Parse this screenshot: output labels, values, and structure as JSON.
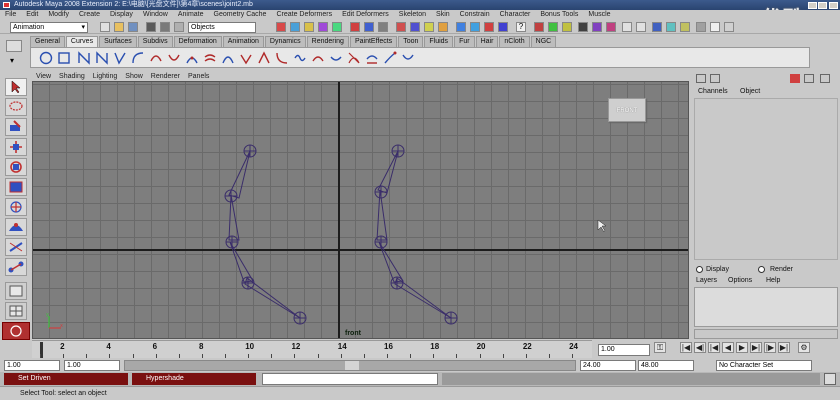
{
  "window": {
    "title": "Autodesk Maya 2008 Extension 2: E:\\电脑\\[光盘文件]\\第4章\\scenes\\joint2.mb",
    "watermark": "优酷"
  },
  "menubar": {
    "items": [
      "File",
      "Edit",
      "Modify",
      "Create",
      "Display",
      "Window",
      "Animate",
      "Geometry Cache",
      "Create Deformers",
      "Edit Deformers",
      "Skeleton",
      "Skin",
      "Constrain",
      "Character",
      "Bonus Tools",
      "Muscle"
    ]
  },
  "statusline": {
    "menuset": "Animation",
    "objects_field": "Objects"
  },
  "shelf": {
    "tabs": [
      "General",
      "Curves",
      "Surfaces",
      "Subdivs",
      "Deformation",
      "Animation",
      "Dynamics",
      "Rendering",
      "PaintEffects",
      "Toon",
      "Fluids",
      "Fur",
      "Hair",
      "nCloth",
      "NGC"
    ],
    "active_tab": "Curves"
  },
  "panel_menu": {
    "items": [
      "View",
      "Shading",
      "Lighting",
      "Show",
      "Renderer",
      "Panels"
    ]
  },
  "viewport": {
    "camera_label": "front",
    "viewcube_label": "FRONT"
  },
  "channel_box": {
    "menu_channels": "Channels",
    "menu_object": "Object"
  },
  "layer_editor": {
    "display_label": "Display",
    "render_label": "Render",
    "menu_layers": "Layers",
    "menu_options": "Options",
    "menu_help": "Help"
  },
  "timeslider": {
    "ticks": [
      "2",
      "4",
      "6",
      "8",
      "10",
      "12",
      "14",
      "16",
      "18",
      "20",
      "22",
      "24"
    ],
    "current_frame": "1.00"
  },
  "rangeslider": {
    "start_time": "1.00",
    "playback_start": "1.00",
    "playback_end": "24.00",
    "end_time": "48.00",
    "character_set": "No Character Set"
  },
  "taskbar": {
    "item1": "Set Driven",
    "item2": "Hypershade"
  },
  "helpline": {
    "text": "Select Tool: select an object"
  },
  "colors": {
    "joint_color": "#3a2d6a",
    "viewport_bg": "#7e7e7e",
    "grid_line": "#6a6a6a"
  }
}
